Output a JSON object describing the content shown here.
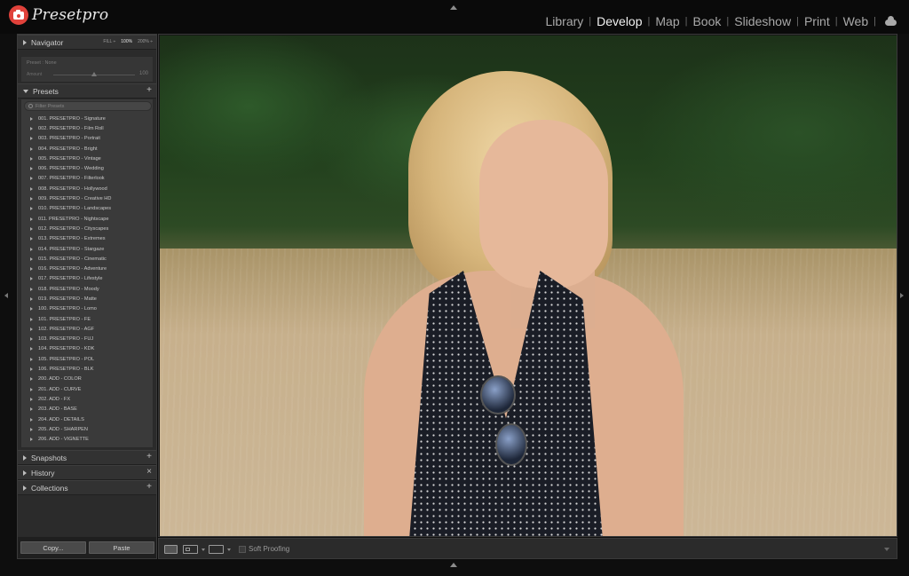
{
  "app": {
    "brand": "Presetpro"
  },
  "modules": [
    {
      "label": "Library",
      "active": false
    },
    {
      "label": "Develop",
      "active": true
    },
    {
      "label": "Map",
      "active": false
    },
    {
      "label": "Book",
      "active": false
    },
    {
      "label": "Slideshow",
      "active": false
    },
    {
      "label": "Print",
      "active": false
    },
    {
      "label": "Web",
      "active": false
    }
  ],
  "module_separator": "|",
  "navigator": {
    "title": "Navigator",
    "zoom": [
      {
        "label": "FILL ÷",
        "active": false
      },
      {
        "label": "100%",
        "active": true
      },
      {
        "label": "200% ÷",
        "active": false
      }
    ]
  },
  "preset_preview": {
    "name": "Preset : None",
    "amount_label": "Amount",
    "amount_value": "100",
    "amount_fraction": 0.5
  },
  "presets": {
    "title": "Presets",
    "add": "+",
    "filter_placeholder": "Filter Presets",
    "items": [
      "001. PRESETPRO - Signature",
      "002. PRESETPRO - Film Roll",
      "003. PRESETPRO - Portrait",
      "004. PRESETPRO - Bright",
      "005. PRESETPRO - Vintage",
      "006. PRESETPRO - Wedding",
      "007. PRESETPRO - Filterlook",
      "008. PRESETPRO - Hollywood",
      "009. PRESETPRO - Creative HD",
      "010. PRESETPRO - Landscapes",
      "011. PRESETPRO - Nightscape",
      "012. PRESETPRO - Cityscapes",
      "013. PRESETPRO - Extremes",
      "014. PRESETPRO - Stargaze",
      "015. PRESETPRO - Cinematic",
      "016. PRESETPRO - Adventure",
      "017. PRESETPRO - Lifestyle",
      "018. PRESETPRO - Moody",
      "019. PRESETPRO - Matte",
      "100. PRESETPRO - Lomo",
      "101. PRESETPRO - FE",
      "102. PRESETPRO - AGF",
      "103. PRESETPRO - FUJ",
      "104. PRESETPRO - KDK",
      "105. PRESETPRO - POL",
      "106. PRESETPRO - BLK",
      "200. ADD - COLOR",
      "201. ADD - CURVE",
      "202. ADD - FX",
      "203. ADD - BASE",
      "204. ADD - DETAILS",
      "205. ADD - SHARPEN",
      "206. ADD - VIGNETTE"
    ]
  },
  "snapshots": {
    "title": "Snapshots",
    "action": "+"
  },
  "history": {
    "title": "History",
    "action": "×"
  },
  "collections": {
    "title": "Collections",
    "action": "+"
  },
  "buttons": {
    "copy": "Copy...",
    "paste": "Paste"
  },
  "toolbar": {
    "soft_proofing": "Soft Proofing"
  },
  "colors": {
    "accent_logo": "#e0423b",
    "background": "#0e0e0e",
    "panel": "#2b2b2b"
  }
}
